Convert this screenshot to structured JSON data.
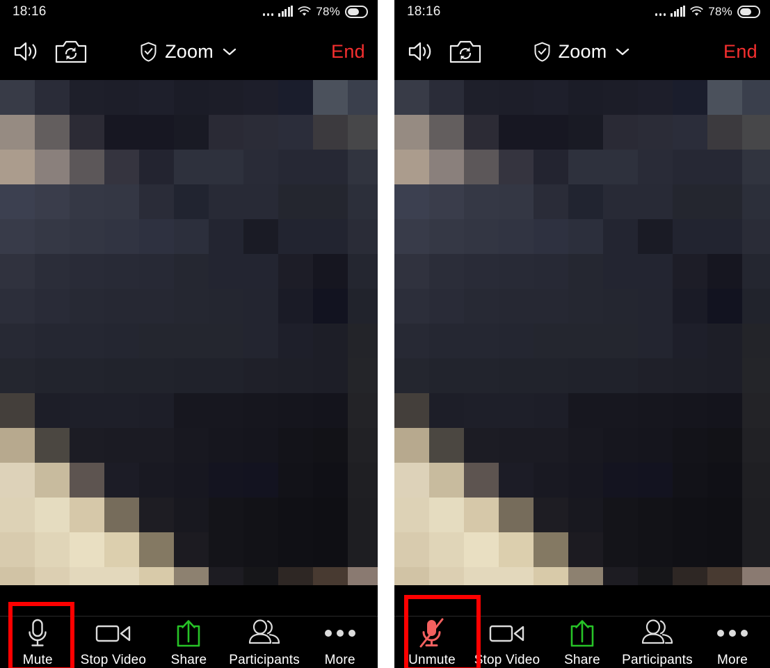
{
  "status_bar": {
    "time": "18:16",
    "battery_percent": "78%",
    "battery_level": 62,
    "icons": [
      "dots-icon",
      "cellular-signal-icon",
      "wifi-icon",
      "battery-icon"
    ]
  },
  "nav_bar": {
    "speaker_icon": "speaker-on-icon",
    "switch_camera_icon": "switch-camera-icon",
    "shield_icon": "shield-check-icon",
    "title": "Zoom",
    "chevron_icon": "chevron-down-icon",
    "end_label": "End",
    "end_color": "#f52f2f"
  },
  "panels": [
    {
      "id": "left",
      "mic_state": "unmuted",
      "toolbar": [
        {
          "name": "mute-button",
          "label": "Mute",
          "icon": "microphone-icon",
          "color": "#dcdcdc",
          "highlighted": true
        },
        {
          "name": "stop-video-button",
          "label": "Stop Video",
          "icon": "video-camera-icon",
          "color": "#dcdcdc",
          "highlighted": false
        },
        {
          "name": "share-button",
          "label": "Share",
          "icon": "share-upload-icon",
          "color": "#27c327",
          "highlighted": false
        },
        {
          "name": "participants-button",
          "label": "Participants",
          "icon": "participants-icon",
          "color": "#dcdcdc",
          "highlighted": false
        },
        {
          "name": "more-button",
          "label": "More",
          "icon": "more-ellipsis-icon",
          "color": "#dcdcdc",
          "highlighted": false
        }
      ]
    },
    {
      "id": "right",
      "mic_state": "muted",
      "toolbar": [
        {
          "name": "unmute-button",
          "label": "Unmute",
          "icon": "microphone-muted-icon",
          "color": "#f4605f",
          "highlighted": true
        },
        {
          "name": "stop-video-button",
          "label": "Stop Video",
          "icon": "video-camera-icon",
          "color": "#dcdcdc",
          "highlighted": false
        },
        {
          "name": "share-button",
          "label": "Share",
          "icon": "share-upload-icon",
          "color": "#27c327",
          "highlighted": false
        },
        {
          "name": "participants-button",
          "label": "Participants",
          "icon": "participants-icon",
          "color": "#dcdcdc",
          "highlighted": false
        },
        {
          "name": "more-button",
          "label": "More",
          "icon": "more-ellipsis-icon",
          "color": "#dcdcdc",
          "highlighted": false
        }
      ]
    }
  ],
  "highlight_color": "#fe0000",
  "video_feed": {
    "description": "pixelated-video-mosaic",
    "block_size": 50,
    "columns": 11,
    "rows": 15,
    "grid": [
      [
        "#383b47",
        "#2a2c38",
        "#1e1f2a",
        "#1d1e29",
        "#1e1f2b",
        "#1b1c27",
        "#1c1d28",
        "#1d1e2a",
        "#1a1d2c",
        "#4b515c",
        "#3a3f4c"
      ],
      [
        "#968b82",
        "#635e5e",
        "#2c2b35",
        "#171722",
        "#171722",
        "#191a24",
        "#2a2a35",
        "#2b2c37",
        "#2b2d3a",
        "#3c3a3e",
        "#474749"
      ],
      [
        "#ab9c8d",
        "#8a807c",
        "#5c5759",
        "#35343f",
        "#232430",
        "#2e313d",
        "#2e313d",
        "#292b37",
        "#262834",
        "#262834",
        "#31343f"
      ],
      [
        "#3c4050",
        "#3a3d4b",
        "#353845",
        "#343744",
        "#2a2c38",
        "#212430",
        "#282a36",
        "#282a36",
        "#24262f",
        "#24262f",
        "#2c2f3a"
      ],
      [
        "#383b49",
        "#353845",
        "#333643",
        "#313442",
        "#2e3140",
        "#2c2f3c",
        "#232531",
        "#1a1b25",
        "#222430",
        "#222430",
        "#2a2c37"
      ],
      [
        "#30323e",
        "#2b2d39",
        "#292b37",
        "#282a36",
        "#272935",
        "#252731",
        "#232531",
        "#232531",
        "#1d1d27",
        "#161620",
        "#242630"
      ],
      [
        "#2c2e3a",
        "#292b37",
        "#272934",
        "#262833",
        "#262833",
        "#252731",
        "#242630",
        "#232530",
        "#1a1b26",
        "#121320",
        "#21232c"
      ],
      [
        "#272934",
        "#252732",
        "#252732",
        "#242631",
        "#24262f",
        "#24262f",
        "#24262f",
        "#232530",
        "#1e1f2a",
        "#1d1e27",
        "#232429"
      ],
      [
        "#24262f",
        "#22242d",
        "#22242d",
        "#21232c",
        "#21232c",
        "#20222b",
        "#20222b",
        "#1f2029",
        "#1e1f28",
        "#1d1e27",
        "#242529"
      ],
      [
        "#443f3b",
        "#1d1e28",
        "#1e1f29",
        "#1e1f29",
        "#1d1e28",
        "#17171f",
        "#17171f",
        "#16161e",
        "#15151d",
        "#14141c",
        "#232327"
      ],
      [
        "#b7a98e",
        "#4b4741",
        "#1c1c24",
        "#1b1b23",
        "#1b1b23",
        "#181820",
        "#16161e",
        "#15151d",
        "#131319",
        "#121217",
        "#212125"
      ],
      [
        "#ddd2b9",
        "#c8bb9e",
        "#5d5450",
        "#1c1c26",
        "#191922",
        "#171720",
        "#141420",
        "#131320",
        "#121218",
        "#101016",
        "#1f1f23"
      ],
      [
        "#ddd2b6",
        "#e5dcc0",
        "#d6c8a9",
        "#766c5b",
        "#1e1d23",
        "#18181f",
        "#141419",
        "#121217",
        "#101015",
        "#0f0f14",
        "#1e1e22"
      ],
      [
        "#d8cbae",
        "#e0d5b8",
        "#e9dfc2",
        "#dccfae",
        "#847963",
        "#1c1b21",
        "#141419",
        "#121217",
        "#101015",
        "#0f0f14",
        "#1e1e22"
      ],
      [
        "#d1c3a5",
        "#dccfb2",
        "#e3d8bc",
        "#e3d8bc",
        "#d8caa9",
        "#8d8170",
        "#1d1c22",
        "#161619",
        "#2e2724",
        "#483a31",
        "#8a7a71"
      ],
      [
        "#c4b79b",
        "#cfc2a7",
        "#d4c7ac",
        "#d4c7ac",
        "#d3c6ab",
        "#c5b99e",
        "#7e7463",
        "#1c1b20",
        "#2e2724",
        "#4a3c33",
        "#8d7d73"
      ]
    ]
  }
}
